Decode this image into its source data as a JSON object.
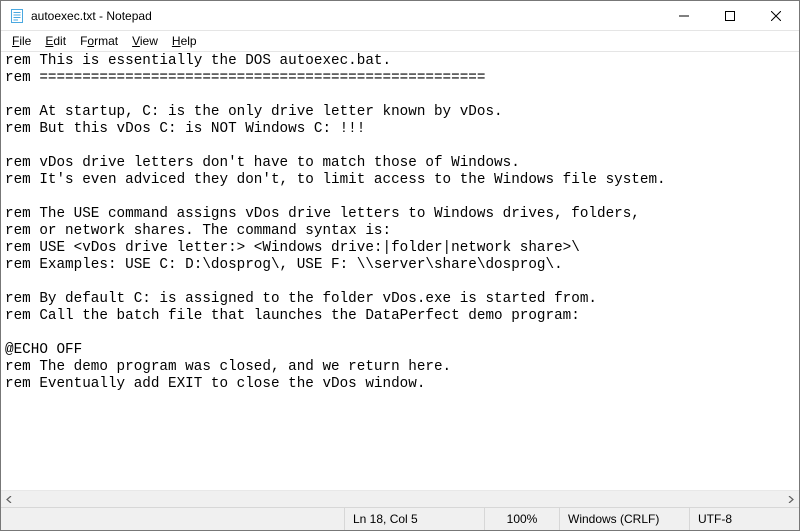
{
  "title": "autoexec.txt - Notepad",
  "menu": {
    "file": "File",
    "edit": "Edit",
    "format": "Format",
    "view": "View",
    "help": "Help"
  },
  "content": "rem This is essentially the DOS autoexec.bat.\nrem ====================================================\n\nrem At startup, C: is the only drive letter known by vDos.\nrem But this vDos C: is NOT Windows C: !!!\n\nrem vDos drive letters don't have to match those of Windows.\nrem It's even adviced they don't, to limit access to the Windows file system.\n\nrem The USE command assigns vDos drive letters to Windows drives, folders,\nrem or network shares. The command syntax is:\nrem USE <vDos drive letter:> <Windows drive:|folder|network share>\\\nrem Examples: USE C: D:\\dosprog\\, USE F: \\\\server\\share\\dosprog\\.\n\nrem By default C: is assigned to the folder vDos.exe is started from.\nrem Call the batch file that launches the DataPerfect demo program:\n\n@ECHO OFF\nrem The demo program was closed, and we return here.\nrem Eventually add EXIT to close the vDos window.",
  "status": {
    "position": "Ln 18, Col 5",
    "zoom": "100%",
    "eol": "Windows (CRLF)",
    "encoding": "UTF-8"
  }
}
